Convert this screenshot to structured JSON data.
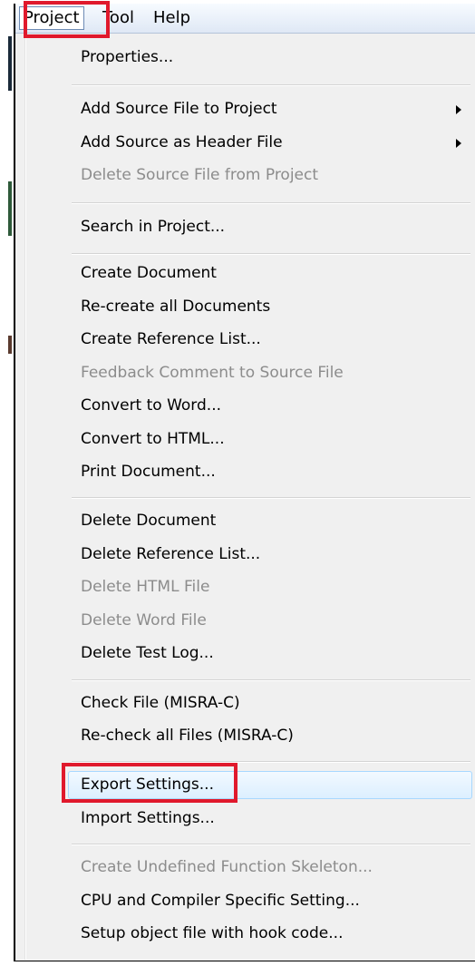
{
  "menubar": {
    "items": [
      "Project",
      "Tool",
      "Help"
    ]
  },
  "menu": {
    "items": [
      {
        "label": "Properties...",
        "disabled": false,
        "submenu": false
      },
      {
        "label": "Add Source File to Project",
        "disabled": false,
        "submenu": true
      },
      {
        "label": "Add Source as Header File",
        "disabled": false,
        "submenu": true
      },
      {
        "label": "Delete Source File from Project",
        "disabled": true,
        "submenu": false
      },
      {
        "label": "Search in Project...",
        "disabled": false,
        "submenu": false
      },
      {
        "label": "Create Document",
        "disabled": false,
        "submenu": false
      },
      {
        "label": "Re-create all Documents",
        "disabled": false,
        "submenu": false
      },
      {
        "label": "Create Reference List...",
        "disabled": false,
        "submenu": false
      },
      {
        "label": "Feedback Comment to Source File",
        "disabled": true,
        "submenu": false
      },
      {
        "label": "Convert to Word...",
        "disabled": false,
        "submenu": false
      },
      {
        "label": "Convert to HTML...",
        "disabled": false,
        "submenu": false
      },
      {
        "label": "Print Document...",
        "disabled": false,
        "submenu": false
      },
      {
        "label": "Delete Document",
        "disabled": false,
        "submenu": false
      },
      {
        "label": "Delete Reference List...",
        "disabled": false,
        "submenu": false
      },
      {
        "label": "Delete HTML File",
        "disabled": true,
        "submenu": false
      },
      {
        "label": "Delete Word File",
        "disabled": true,
        "submenu": false
      },
      {
        "label": "Delete Test Log...",
        "disabled": false,
        "submenu": false
      },
      {
        "label": "Check File (MISRA-C)",
        "disabled": false,
        "submenu": false
      },
      {
        "label": "Re-check all Files (MISRA-C)",
        "disabled": false,
        "submenu": false
      },
      {
        "label": "Export Settings...",
        "disabled": false,
        "submenu": false,
        "hover": true
      },
      {
        "label": "Import Settings...",
        "disabled": false,
        "submenu": false
      },
      {
        "label": "Create Undefined Function Skeleton...",
        "disabled": true,
        "submenu": false
      },
      {
        "label": "CPU and Compiler Specific Setting...",
        "disabled": false,
        "submenu": false
      },
      {
        "label": "Setup object file with hook code...",
        "disabled": false,
        "submenu": false
      }
    ]
  },
  "colors": {
    "highlight_box": "#e0192c",
    "disabled_text": "#8c8c8c",
    "menu_bg": "#f0f0f0"
  }
}
